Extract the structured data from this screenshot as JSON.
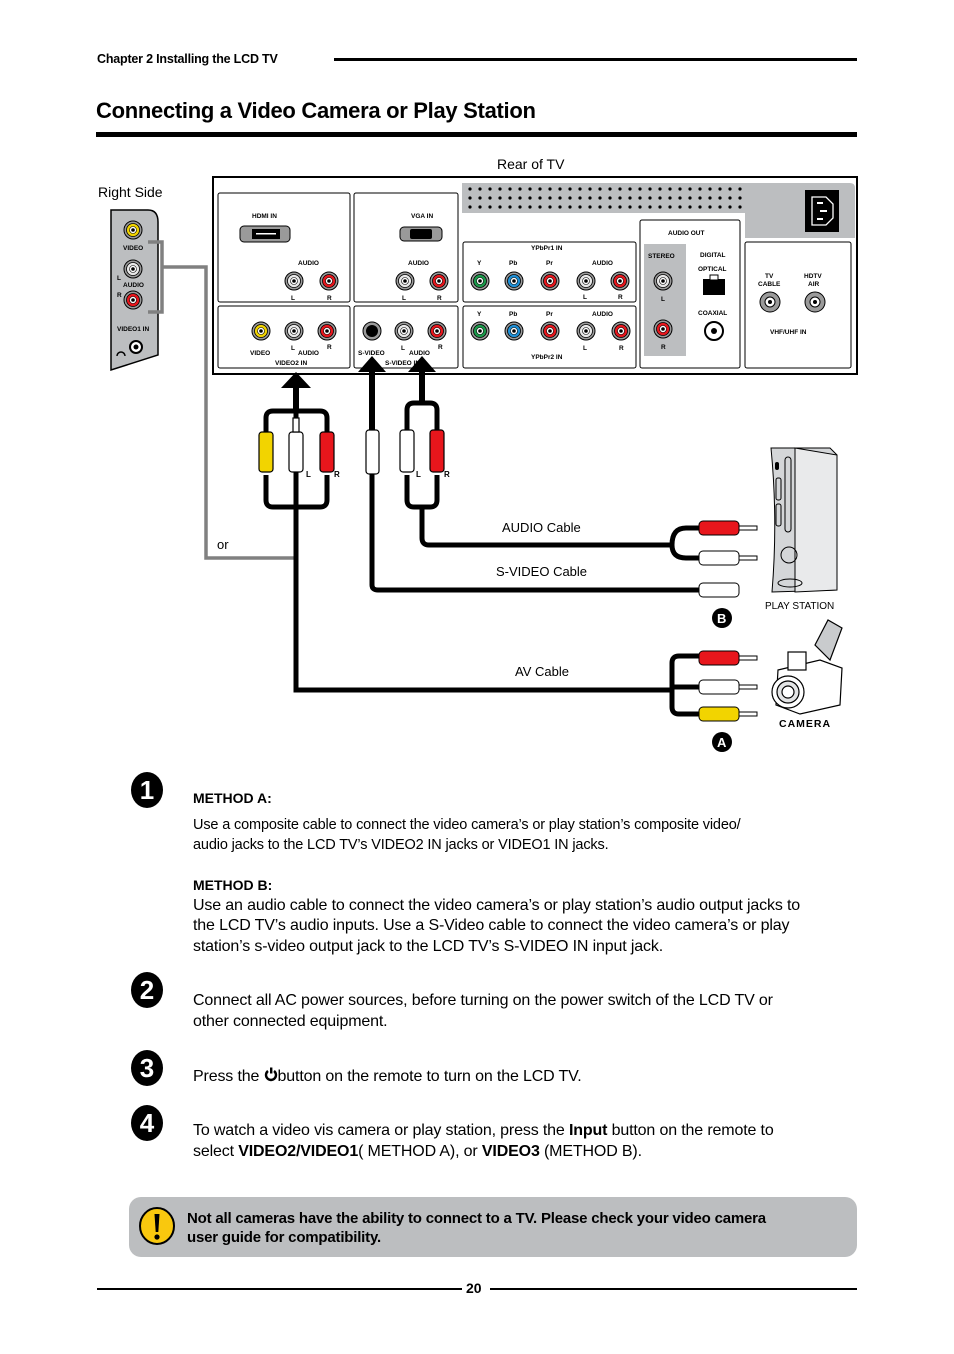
{
  "header": {
    "chapter": "Chapter 2 Installing the LCD TV",
    "title": "Connecting a Video Camera or Play Station"
  },
  "diagram": {
    "rear_label": "Rear of TV",
    "side_label": "Right Side",
    "or_label": "or",
    "side_panel": {
      "video": "VIDEO",
      "audio": "AUDIO",
      "l": "L",
      "r": "R",
      "video1_in": "VIDEO1 IN"
    },
    "rear_panel": {
      "hdmi_in": "HDMI IN",
      "vga_in": "VGA IN",
      "audio": "AUDIO",
      "l": "L",
      "r": "R",
      "video": "VIDEO",
      "video2_in": "VIDEO2 IN",
      "s_video": "S-VIDEO",
      "s_video_in": "S-VIDEO IN",
      "ypbpr1_in": "YPbPr1 IN",
      "ypbpr2_in": "YPbPr2 IN",
      "y": "Y",
      "pb": "Pb",
      "pr": "Pr",
      "audio_out": "AUDIO OUT",
      "stereo": "STEREO",
      "digital": "DIGITAL",
      "optical": "OPTICAL",
      "coaxial": "COAXIAL",
      "tv": "TV",
      "cable": "CABLE",
      "hdtv": "HDTV",
      "air": "AIR",
      "vhf_uhf_in": "VHF/UHF IN"
    },
    "plug_l": "L",
    "plug_r": "R",
    "audio_cable": "AUDIO Cable",
    "svideo_cable": "S-VIDEO Cable",
    "av_cable": "AV Cable",
    "play_station": "PLAY STATION",
    "camera": "CAMERA",
    "badge_a": "A",
    "badge_b": "B"
  },
  "steps": [
    {
      "number": "1",
      "method_a_heading": "METHOD A:",
      "method_a_line1": "Use a composite cable to connect the video camera’s or play station’s composite video/",
      "method_a_line2": "audio jacks to the LCD TV’s VIDEO2 IN jacks or VIDEO1 IN jacks.",
      "method_b_heading": "METHOD B:",
      "method_b_line1": "Use an audio cable to connect the video camera’s or play station’s audio output jacks to",
      "method_b_line2": "the LCD TV’s audio inputs. Use a S-Video cable to connect the video camera’s or play",
      "method_b_line3": "station’s s-video output jack to the LCD TV’s S-VIDEO IN input jack."
    },
    {
      "number": "2",
      "line1": "Connect all AC power sources, before turning on the power switch of the LCD TV or",
      "line2": "other connected equipment."
    },
    {
      "number": "3",
      "before_icon": "Press the ",
      "icon": "power-icon",
      "after_icon": "button on the remote to turn on the LCD TV."
    },
    {
      "number": "4",
      "line1_a": "To watch a video vis camera or play station, press the ",
      "line1_bold": "Input",
      "line1_b": " button on the remote to",
      "line2_a": "select ",
      "line2_bold1": "VIDEO2/VIDEO1",
      "line2_b": "( METHOD A), or ",
      "line2_bold2": "VIDEO3",
      "line2_c": " (METHOD B)."
    }
  ],
  "note": {
    "icon": "warning-icon",
    "line1": "Not all cameras have the ability to connect to a TV. Please check your video camera",
    "line2": "user guide for compatibility."
  },
  "footer": {
    "page_number": "20"
  },
  "colors": {
    "yellow_jack": "#f2d400",
    "red_jack": "#e8161c",
    "white_jack": "#e8e8e8",
    "green_jack": "#1a9a4a",
    "blue_jack": "#1e8fd6",
    "panel_gray": "#bcbec0",
    "note_gray": "#bcbec0"
  }
}
